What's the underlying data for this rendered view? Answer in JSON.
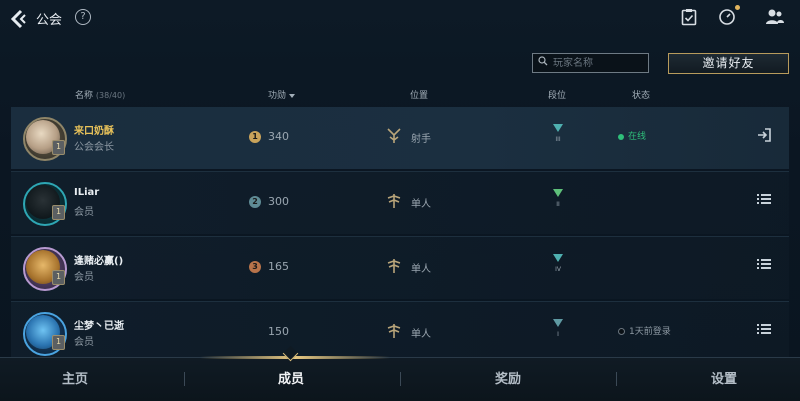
{
  "topbar": {
    "title": "公会",
    "icons": [
      "back-arrow-icon",
      "help-icon",
      "clipboard-check-icon",
      "timer-icon",
      "friends-icon"
    ]
  },
  "search": {
    "placeholder": "玩家名称"
  },
  "invite_label": "邀请好友",
  "columns": {
    "name": "名称",
    "name_count": "(38/40)",
    "merit": "功勋",
    "position": "位置",
    "rank": "段位",
    "status": "状态"
  },
  "members": [
    {
      "name": "来口奶酥",
      "role": "公会会长",
      "merit_rank": "1",
      "merit": "340",
      "position": "射手",
      "rank_tier": "III",
      "status": "在线",
      "badge": "1",
      "action_icon": "exit-icon"
    },
    {
      "name": "ILiar",
      "role": "会员",
      "merit_rank": "2",
      "merit": "300",
      "position": "单人",
      "rank_tier": "II",
      "status": "",
      "badge": "1",
      "action_icon": "menu-icon"
    },
    {
      "name": "逢赌必赢()",
      "role": "会员",
      "merit_rank": "3",
      "merit": "165",
      "position": "单人",
      "rank_tier": "IV",
      "status": "",
      "badge": "1",
      "action_icon": "menu-icon"
    },
    {
      "name": "尘梦丶已逝",
      "role": "会员",
      "merit_rank": "",
      "merit": "150",
      "position": "单人",
      "rank_tier": "I",
      "status": "1天前登录",
      "badge": "1",
      "action_icon": "menu-icon"
    }
  ],
  "tabs": [
    {
      "label": "主页"
    },
    {
      "label": "成员",
      "active": true
    },
    {
      "label": "奖励"
    },
    {
      "label": "设置"
    }
  ],
  "colors": {
    "online": "#2fbf7a",
    "leader_name": "#e8c25a",
    "accent_gold": "#e8c982"
  }
}
